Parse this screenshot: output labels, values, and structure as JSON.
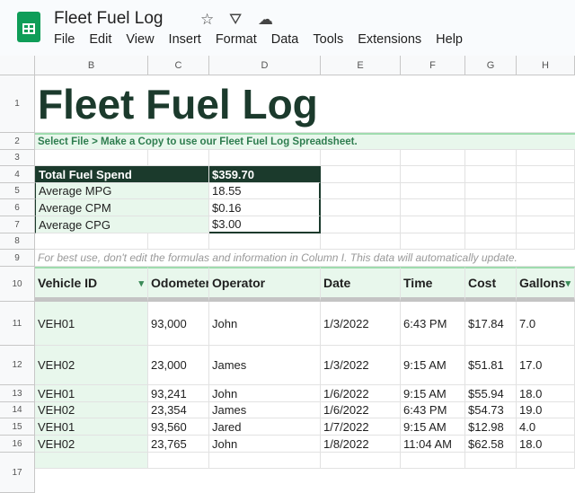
{
  "app": {
    "title": "Fleet Fuel Log",
    "menu": [
      "File",
      "Edit",
      "View",
      "Insert",
      "Format",
      "Data",
      "Tools",
      "Extensions",
      "Help"
    ]
  },
  "columns": [
    "",
    "B",
    "C",
    "D",
    "E",
    "F",
    "G",
    "H"
  ],
  "rows": [
    "1",
    "2",
    "3",
    "4",
    "5",
    "6",
    "7",
    "8",
    "9",
    "10",
    "11",
    "12",
    "13",
    "14",
    "15",
    "16",
    "17"
  ],
  "sheet": {
    "heading": "Fleet Fuel Log",
    "instruction": "Select File > Make a Copy to use our Fleet Fuel Log Spreadsheet.",
    "summary": [
      [
        "Total Fuel Spend",
        "$359.70"
      ],
      [
        "Average MPG",
        "18.55"
      ],
      [
        "Average CPM",
        "$0.16"
      ],
      [
        "Average CPG",
        "$3.00"
      ]
    ],
    "note": "For best use, don't edit the formulas and information in Column I. This data will automatically update.",
    "headers": [
      "Vehicle ID",
      "Odometer",
      "Operator",
      "Date",
      "Time",
      "Cost",
      "Gallons"
    ],
    "data": [
      [
        "VEH01",
        "93,000",
        "John",
        "1/3/2022",
        "6:43 PM",
        "$17.84",
        "7.0"
      ],
      [
        "VEH02",
        "23,000",
        "James",
        "1/3/2022",
        "9:15 AM",
        "$51.81",
        "17.0"
      ],
      [
        "VEH01",
        "93,241",
        "John",
        "1/6/2022",
        "9:15 AM",
        "$55.94",
        "18.0"
      ],
      [
        "VEH02",
        "23,354",
        "James",
        "1/6/2022",
        "6:43 PM",
        "$54.73",
        "19.0"
      ],
      [
        "VEH01",
        "93,560",
        "Jared",
        "1/7/2022",
        "9:15 AM",
        "$12.98",
        "4.0"
      ],
      [
        "VEH02",
        "23,765",
        "John",
        "1/8/2022",
        "11:04 AM",
        "$62.58",
        "18.0"
      ]
    ]
  },
  "colors": {
    "dark": "#1b3a2c",
    "green": "#2e7d4f",
    "lightgreen": "#e8f7ec"
  }
}
